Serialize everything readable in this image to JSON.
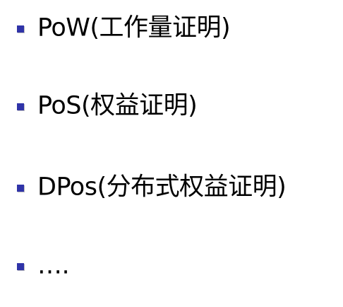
{
  "colors": {
    "background": "#ffffff",
    "bullet": "#2f33a8",
    "text": "#000000"
  },
  "bullets": [
    {
      "icon": "square-bullet-icon",
      "text": "PoW(工作量证明)"
    },
    {
      "icon": "square-bullet-icon",
      "text": "PoS(权益证明)"
    },
    {
      "icon": "square-bullet-icon",
      "text": "DPos(分布式权益证明)"
    },
    {
      "icon": "square-bullet-icon",
      "text": "…."
    }
  ]
}
